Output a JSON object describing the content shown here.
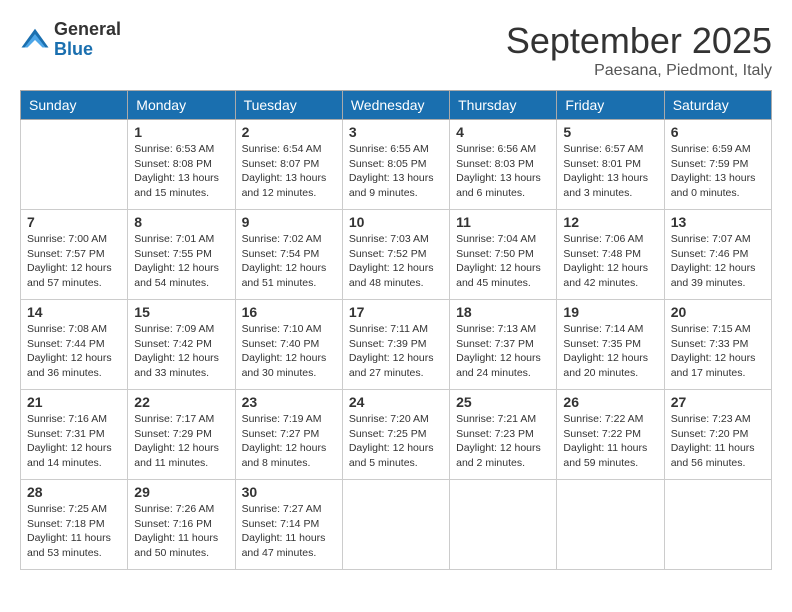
{
  "logo": {
    "general": "General",
    "blue": "Blue"
  },
  "title": "September 2025",
  "subtitle": "Paesana, Piedmont, Italy",
  "days": [
    "Sunday",
    "Monday",
    "Tuesday",
    "Wednesday",
    "Thursday",
    "Friday",
    "Saturday"
  ],
  "weeks": [
    [
      {
        "day": "",
        "info": ""
      },
      {
        "day": "1",
        "info": "Sunrise: 6:53 AM\nSunset: 8:08 PM\nDaylight: 13 hours\nand 15 minutes."
      },
      {
        "day": "2",
        "info": "Sunrise: 6:54 AM\nSunset: 8:07 PM\nDaylight: 13 hours\nand 12 minutes."
      },
      {
        "day": "3",
        "info": "Sunrise: 6:55 AM\nSunset: 8:05 PM\nDaylight: 13 hours\nand 9 minutes."
      },
      {
        "day": "4",
        "info": "Sunrise: 6:56 AM\nSunset: 8:03 PM\nDaylight: 13 hours\nand 6 minutes."
      },
      {
        "day": "5",
        "info": "Sunrise: 6:57 AM\nSunset: 8:01 PM\nDaylight: 13 hours\nand 3 minutes."
      },
      {
        "day": "6",
        "info": "Sunrise: 6:59 AM\nSunset: 7:59 PM\nDaylight: 13 hours\nand 0 minutes."
      }
    ],
    [
      {
        "day": "7",
        "info": "Sunrise: 7:00 AM\nSunset: 7:57 PM\nDaylight: 12 hours\nand 57 minutes."
      },
      {
        "day": "8",
        "info": "Sunrise: 7:01 AM\nSunset: 7:55 PM\nDaylight: 12 hours\nand 54 minutes."
      },
      {
        "day": "9",
        "info": "Sunrise: 7:02 AM\nSunset: 7:54 PM\nDaylight: 12 hours\nand 51 minutes."
      },
      {
        "day": "10",
        "info": "Sunrise: 7:03 AM\nSunset: 7:52 PM\nDaylight: 12 hours\nand 48 minutes."
      },
      {
        "day": "11",
        "info": "Sunrise: 7:04 AM\nSunset: 7:50 PM\nDaylight: 12 hours\nand 45 minutes."
      },
      {
        "day": "12",
        "info": "Sunrise: 7:06 AM\nSunset: 7:48 PM\nDaylight: 12 hours\nand 42 minutes."
      },
      {
        "day": "13",
        "info": "Sunrise: 7:07 AM\nSunset: 7:46 PM\nDaylight: 12 hours\nand 39 minutes."
      }
    ],
    [
      {
        "day": "14",
        "info": "Sunrise: 7:08 AM\nSunset: 7:44 PM\nDaylight: 12 hours\nand 36 minutes."
      },
      {
        "day": "15",
        "info": "Sunrise: 7:09 AM\nSunset: 7:42 PM\nDaylight: 12 hours\nand 33 minutes."
      },
      {
        "day": "16",
        "info": "Sunrise: 7:10 AM\nSunset: 7:40 PM\nDaylight: 12 hours\nand 30 minutes."
      },
      {
        "day": "17",
        "info": "Sunrise: 7:11 AM\nSunset: 7:39 PM\nDaylight: 12 hours\nand 27 minutes."
      },
      {
        "day": "18",
        "info": "Sunrise: 7:13 AM\nSunset: 7:37 PM\nDaylight: 12 hours\nand 24 minutes."
      },
      {
        "day": "19",
        "info": "Sunrise: 7:14 AM\nSunset: 7:35 PM\nDaylight: 12 hours\nand 20 minutes."
      },
      {
        "day": "20",
        "info": "Sunrise: 7:15 AM\nSunset: 7:33 PM\nDaylight: 12 hours\nand 17 minutes."
      }
    ],
    [
      {
        "day": "21",
        "info": "Sunrise: 7:16 AM\nSunset: 7:31 PM\nDaylight: 12 hours\nand 14 minutes."
      },
      {
        "day": "22",
        "info": "Sunrise: 7:17 AM\nSunset: 7:29 PM\nDaylight: 12 hours\nand 11 minutes."
      },
      {
        "day": "23",
        "info": "Sunrise: 7:19 AM\nSunset: 7:27 PM\nDaylight: 12 hours\nand 8 minutes."
      },
      {
        "day": "24",
        "info": "Sunrise: 7:20 AM\nSunset: 7:25 PM\nDaylight: 12 hours\nand 5 minutes."
      },
      {
        "day": "25",
        "info": "Sunrise: 7:21 AM\nSunset: 7:23 PM\nDaylight: 12 hours\nand 2 minutes."
      },
      {
        "day": "26",
        "info": "Sunrise: 7:22 AM\nSunset: 7:22 PM\nDaylight: 11 hours\nand 59 minutes."
      },
      {
        "day": "27",
        "info": "Sunrise: 7:23 AM\nSunset: 7:20 PM\nDaylight: 11 hours\nand 56 minutes."
      }
    ],
    [
      {
        "day": "28",
        "info": "Sunrise: 7:25 AM\nSunset: 7:18 PM\nDaylight: 11 hours\nand 53 minutes."
      },
      {
        "day": "29",
        "info": "Sunrise: 7:26 AM\nSunset: 7:16 PM\nDaylight: 11 hours\nand 50 minutes."
      },
      {
        "day": "30",
        "info": "Sunrise: 7:27 AM\nSunset: 7:14 PM\nDaylight: 11 hours\nand 47 minutes."
      },
      {
        "day": "",
        "info": ""
      },
      {
        "day": "",
        "info": ""
      },
      {
        "day": "",
        "info": ""
      },
      {
        "day": "",
        "info": ""
      }
    ]
  ]
}
